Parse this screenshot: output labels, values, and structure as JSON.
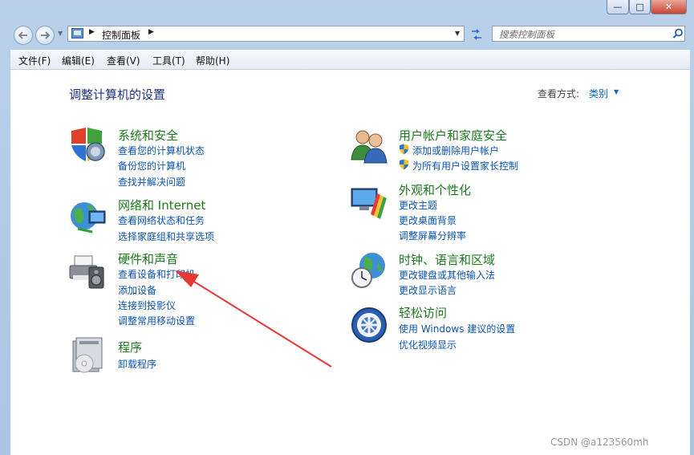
{
  "window": {
    "controls": {
      "minimize": "—",
      "maximize": "□",
      "close": "✕"
    }
  },
  "navigation": {
    "back_icon": "back-arrow-icon",
    "forward_icon": "forward-arrow-icon",
    "breadcrumb": "控制面板",
    "breadcrumb_sep": "▶",
    "search_placeholder": "搜索控制面板"
  },
  "menubar": {
    "items": [
      "文件(F)",
      "编辑(E)",
      "查看(V)",
      "工具(T)",
      "帮助(H)"
    ]
  },
  "header": {
    "title": "调整计算机的设置",
    "view_by_label": "查看方式:",
    "view_by_value": "类别"
  },
  "categories": [
    {
      "title": "系统和安全",
      "icon": "system-security-shield-icon",
      "links": [
        "查看您的计算机状态",
        "备份您的计算机",
        "查找并解决问题"
      ]
    },
    {
      "title": "网络和 Internet",
      "icon": "network-globe-icon",
      "links": [
        "查看网络状态和任务",
        "选择家庭组和共享选项"
      ]
    },
    {
      "title": "硬件和声音",
      "icon": "printer-speaker-icon",
      "links": [
        "查看设备和打印机",
        "添加设备",
        "连接到投影仪",
        "调整常用移动设置"
      ]
    },
    {
      "title": "程序",
      "icon": "programs-disc-icon",
      "links": [
        "卸载程序"
      ]
    },
    {
      "title": "用户帐户和家庭安全",
      "icon": "users-icon",
      "links": [
        "添加或删除用户帐户",
        "为所有用户设置家长控制"
      ]
    },
    {
      "title": "外观和个性化",
      "icon": "display-color-icon",
      "links": [
        "更改主题",
        "更改桌面背景",
        "调整屏幕分辨率"
      ]
    },
    {
      "title": "时钟、语言和区域",
      "icon": "clock-globe-icon",
      "links": [
        "更改键盘或其他输入法",
        "更改显示语言"
      ]
    },
    {
      "title": "轻松访问",
      "icon": "ease-of-access-icon",
      "links": [
        "使用 Windows 建议的设置",
        "优化视频显示"
      ]
    }
  ],
  "watermark": "CSDN @a123560mh",
  "colors": {
    "category_title": "#1e7a1e",
    "link": "#0b55b0",
    "page_title": "#1e3287",
    "annotation_arrow": "#e53935"
  }
}
